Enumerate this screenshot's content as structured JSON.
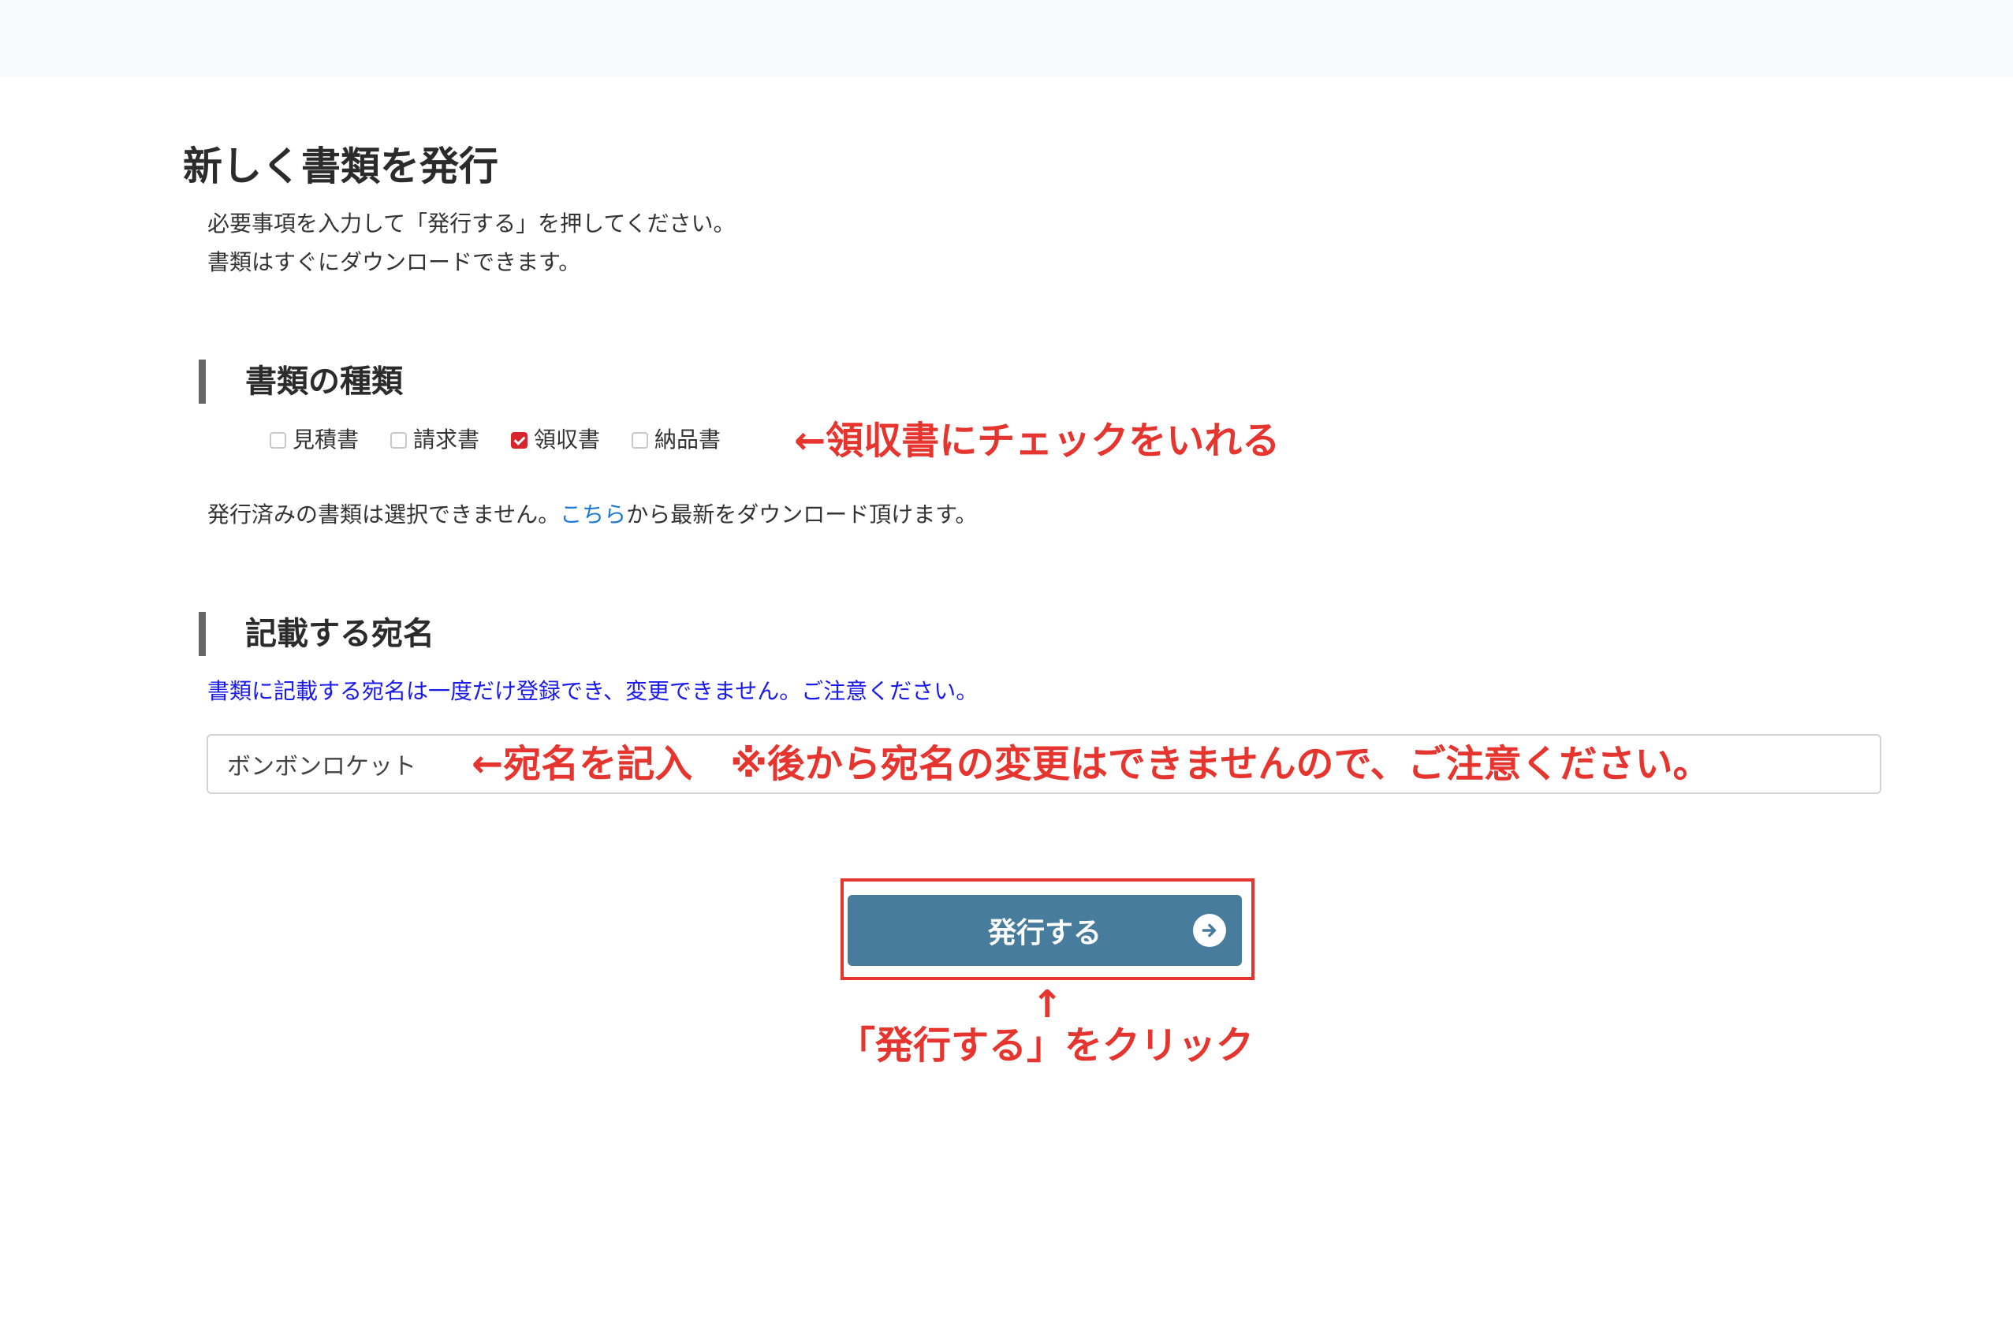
{
  "page": {
    "title": "新しく書類を発行",
    "intro_line1": "必要事項を入力して「発行する」を押してください。",
    "intro_line2": "書類はすぐにダウンロードできます。"
  },
  "doc_type": {
    "heading": "書類の種類",
    "options": [
      {
        "label": "見積書",
        "checked": false
      },
      {
        "label": "請求書",
        "checked": false
      },
      {
        "label": "領収書",
        "checked": true
      },
      {
        "label": "納品書",
        "checked": false
      }
    ],
    "annotation": "←領収書にチェックをいれる",
    "issued_note_before": "発行済みの書類は選択できません。",
    "issued_note_link": "こちら",
    "issued_note_after": "から最新をダウンロード頂けます。"
  },
  "recipient": {
    "heading": "記載する宛名",
    "note": "書類に記載する宛名は一度だけ登録でき、変更できません。ご注意ください。",
    "value": "ボンボンロケット",
    "annotation": "←宛名を記入　※後から宛名の変更はできませんので、ご注意ください。"
  },
  "submit": {
    "label": "発行する",
    "annotation_arrow": "↑",
    "annotation": "「発行する」をクリック"
  },
  "colors": {
    "accent_red": "#e6342e",
    "button_blue": "#477c9c",
    "link_blue": "#1d7ad6",
    "note_blue": "#1a1aea",
    "checkbox_checked": "#d7262b"
  },
  "icons": {
    "submit_icon": "arrow-right-circle-icon"
  }
}
